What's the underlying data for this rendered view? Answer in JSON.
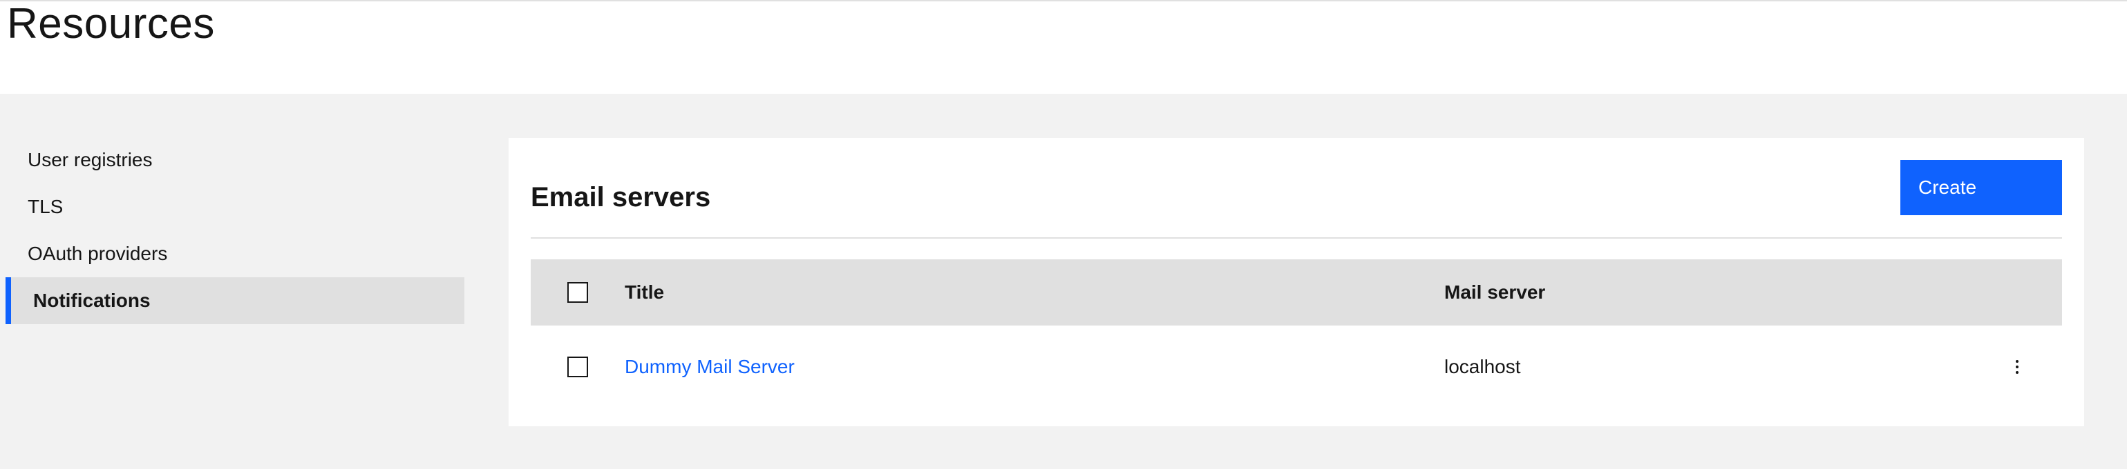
{
  "page": {
    "title": "Resources"
  },
  "sidebar": {
    "items": [
      {
        "label": "User registries"
      },
      {
        "label": "TLS"
      },
      {
        "label": "OAuth providers"
      },
      {
        "label": "Notifications"
      }
    ]
  },
  "email_servers": {
    "title": "Email servers",
    "create_label": "Create",
    "columns": {
      "title": "Title",
      "mail_server": "Mail server"
    },
    "rows": [
      {
        "title": "Dummy Mail Server",
        "mail_server": "localhost"
      }
    ]
  },
  "icons": {
    "row_menu": "overflow-menu-vertical-icon"
  },
  "colors": {
    "accent": "#0f62fe",
    "active_bg": "#e0e0e0",
    "page_bg": "#f2f2f2"
  }
}
